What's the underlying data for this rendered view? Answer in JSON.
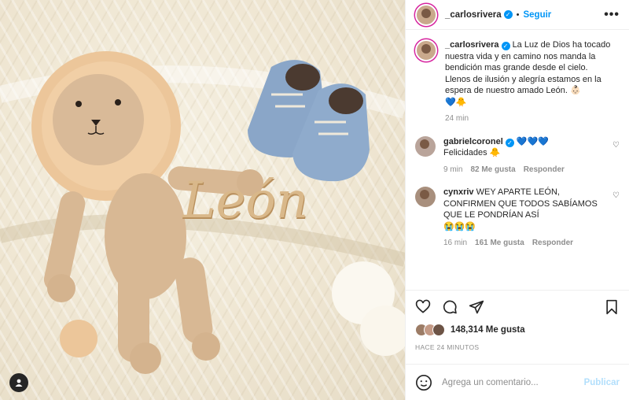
{
  "post": {
    "username": "_carlosrivera",
    "follow_label": "Seguir",
    "caption": "La Luz de Dios ha tocado nuestra vida y en camino nos manda la bendición mas grande desde el cielo.\nLlenos de ilusión y alegría estamos en la espera de nuestro amado León. 👶🏻\n💙🐥",
    "caption_time": "24 min",
    "photo_text": "León",
    "likes": "148,314 Me gusta",
    "posted_ago": "HACE 24 MINUTOS"
  },
  "comments": [
    {
      "username": "gabrielcoronel",
      "text": "💙💙💙\nFelicidades 🐥",
      "time": "9 min",
      "likes": "82 Me gusta",
      "reply": "Responder"
    },
    {
      "username": "cynxriv",
      "text": "WEY APARTE LEÓN, CONFIRMEN QUE TODOS SABÍAMOS QUE LE PONDRÍAN ASÍ\n😭😭😭",
      "time": "16 min",
      "likes": "161 Me gusta",
      "reply": "Responder"
    }
  ],
  "add_comment": {
    "placeholder": "Agrega un comentario...",
    "publish_label": "Publicar"
  },
  "icons": {
    "like": "heart-icon",
    "comment": "comment-icon",
    "share": "share-icon",
    "save": "bookmark-icon",
    "emoji": "emoji-icon",
    "more": "more-icon"
  },
  "colors": {
    "accent": "#0095f6",
    "publish_disabled": "#b2dffc",
    "muted": "#8e8e8e"
  }
}
